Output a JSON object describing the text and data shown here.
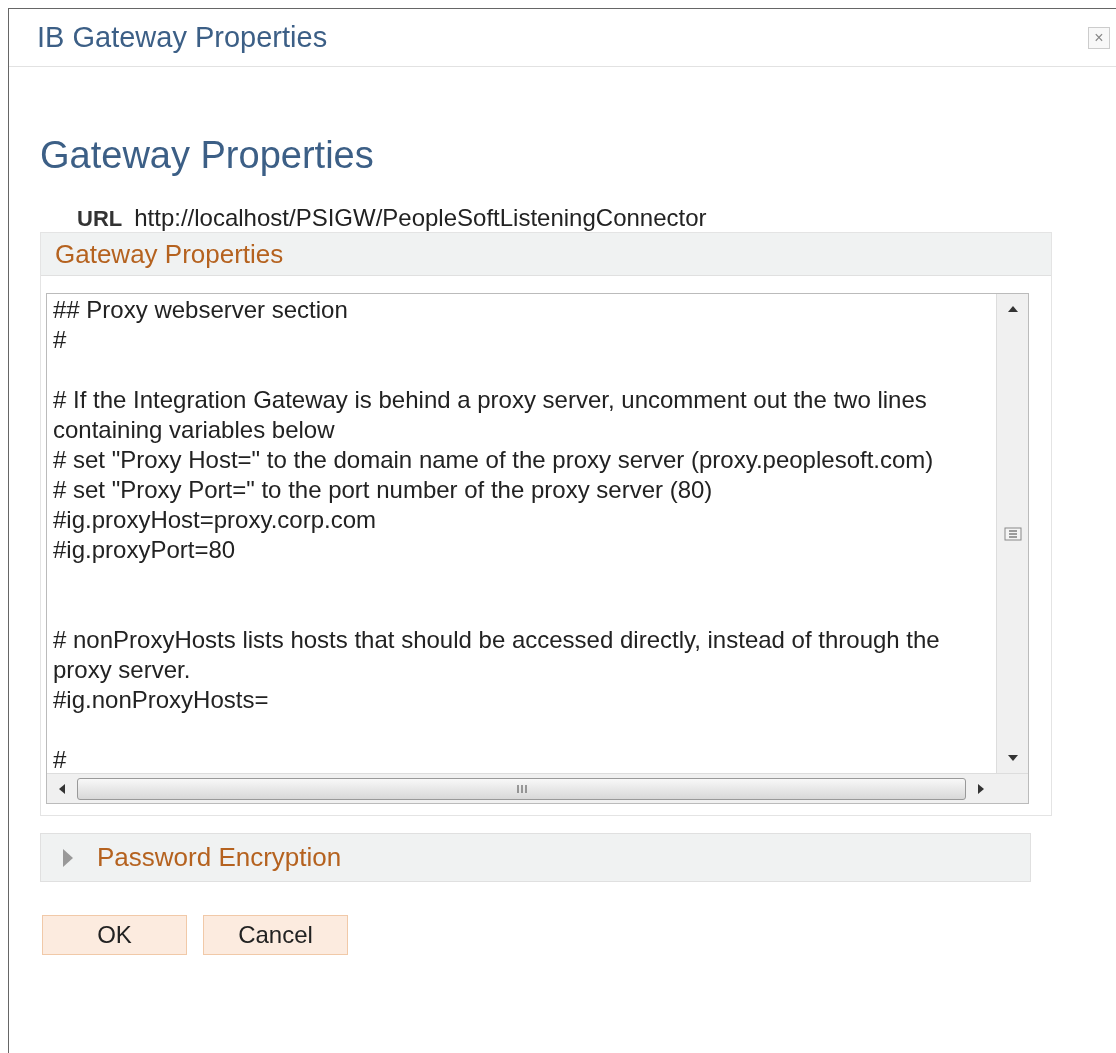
{
  "window": {
    "title": "IB Gateway Properties",
    "close": "×"
  },
  "heading": "Gateway Properties",
  "url": {
    "label": "URL",
    "value": "http://localhost/PSIGW/PeopleSoftListeningConnector"
  },
  "group": {
    "title": "Gateway Properties",
    "value": "## Proxy webserver section\n#\n\n# If the Integration Gateway is behind a proxy server, uncomment out the two lines\ncontaining variables below\n# set \"Proxy Host=\" to the domain name of the proxy server (proxy.peoplesoft.com)\n# set \"Proxy Port=\" to the port number of the proxy server (80)\n#ig.proxyHost=proxy.corp.com\n#ig.proxyPort=80\n\n\n# nonProxyHosts lists hosts that should be accessed directly, instead of through the\nproxy server.\n#ig.nonProxyHosts=\n\n#"
  },
  "section": {
    "title": "Password Encryption",
    "expanded": false
  },
  "buttons": [
    "OK",
    "Cancel"
  ]
}
